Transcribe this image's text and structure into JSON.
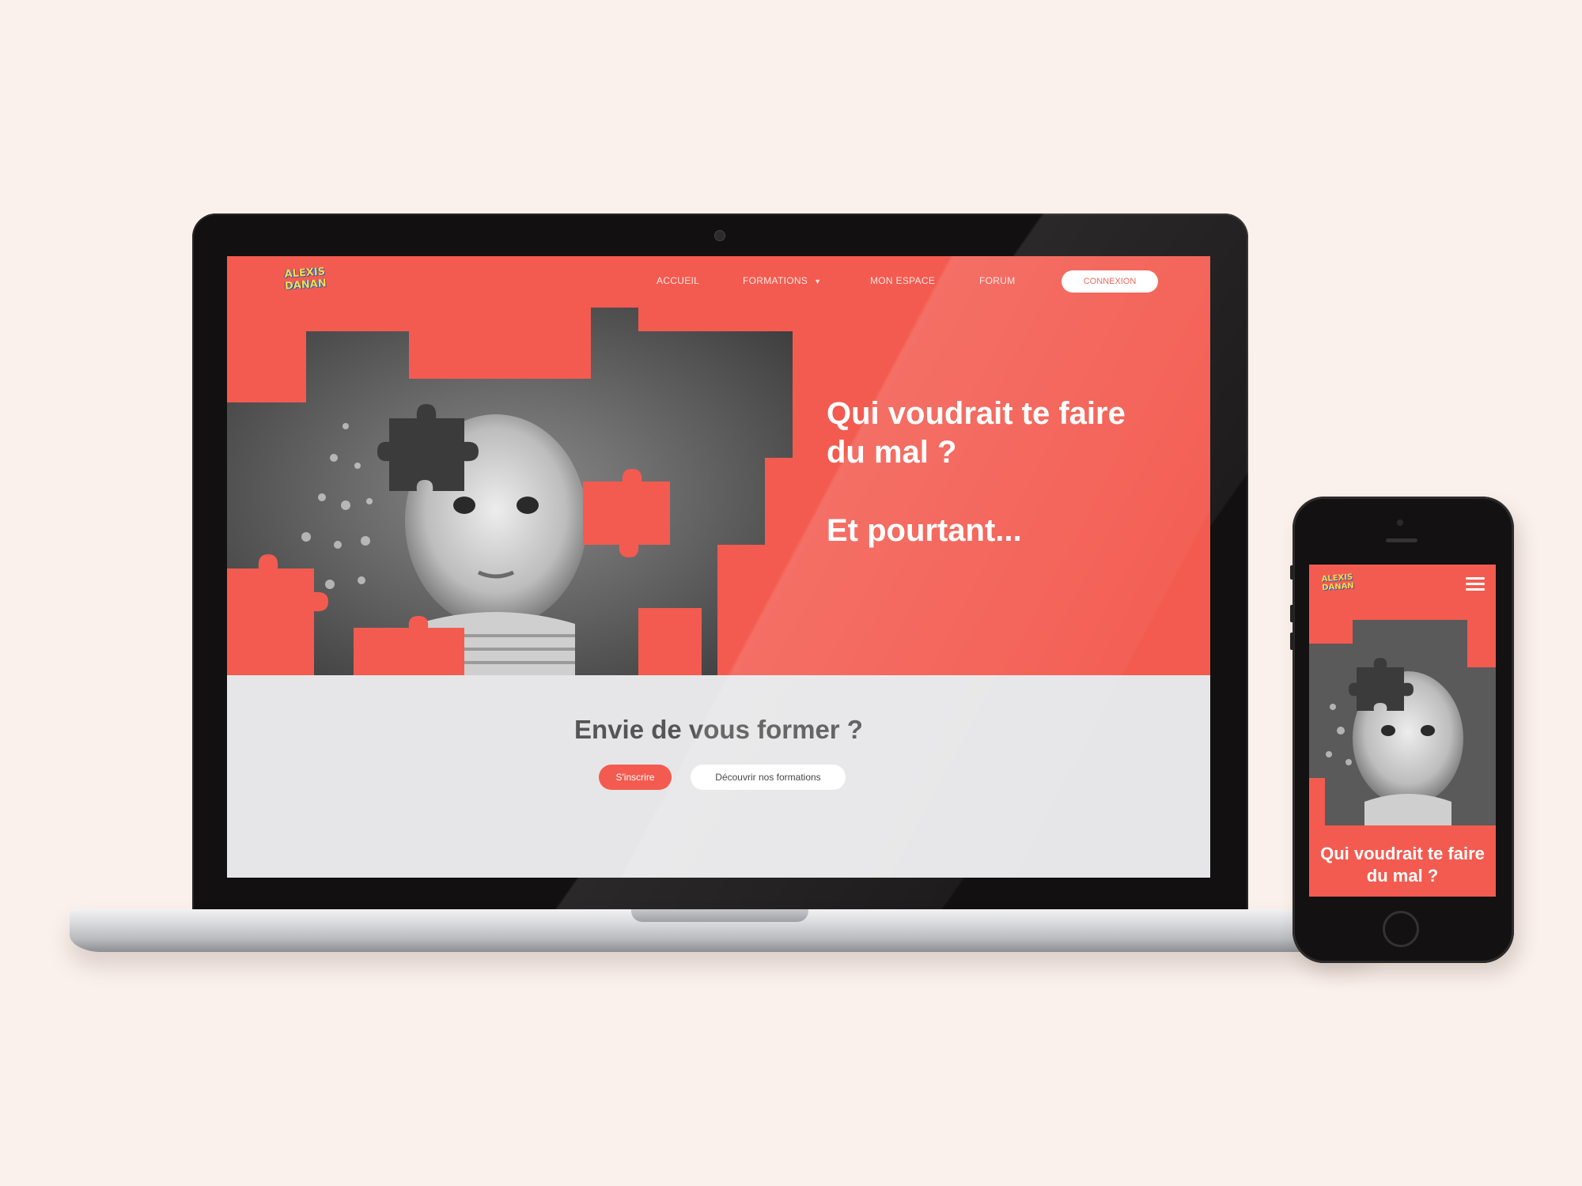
{
  "colors": {
    "brand": "#f35b50",
    "background": "#fbf1ec",
    "section_gray": "#e6e6e8",
    "device_black": "#131112"
  },
  "desktop": {
    "logo": {
      "line1": "ALEXIS",
      "line2": "DANAN"
    },
    "nav": {
      "items": [
        {
          "label": "ACCUEIL"
        },
        {
          "label": "FORMATIONS",
          "icon": "caret-down-icon"
        },
        {
          "label": "MON ESPACE"
        },
        {
          "label": "FORUM"
        }
      ],
      "connexion_label": "CONNEXION"
    },
    "hero": {
      "title": "Qui voudrait te faire du mal ?",
      "subtitle": "Et pourtant..."
    },
    "section2": {
      "title": "Envie de vous former ?",
      "primary_button": "S'inscrire",
      "secondary_button": "Découvrir nos formations"
    }
  },
  "mobile": {
    "logo": {
      "line1": "ALEXIS",
      "line2": "DANAN"
    },
    "menu_icon": "hamburger-menu-icon",
    "hero_title": "Qui voudrait te faire du mal ?"
  }
}
